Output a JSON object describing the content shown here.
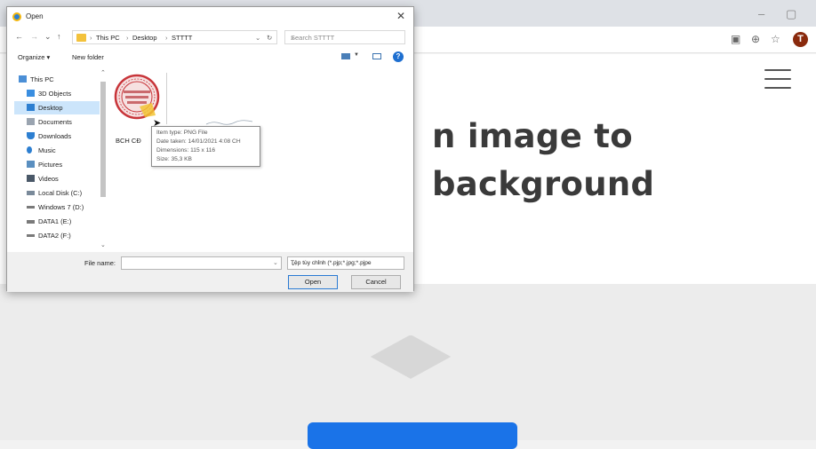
{
  "browser": {
    "window_controls": [
      "–",
      "▢"
    ],
    "profile_initial": "T",
    "headline_line1": "n image to",
    "headline_line2": "background"
  },
  "dialog": {
    "title": "Open",
    "close_glyph": "✕",
    "breadcrumbs": [
      "This PC",
      "Desktop",
      "STTTT"
    ],
    "search_placeholder": "Search STTTT",
    "organize_label": "Organize ▾",
    "new_folder_label": "New folder",
    "nav_items": [
      {
        "label": "This PC",
        "icon": "pc-icon"
      },
      {
        "label": "3D Objects",
        "icon": "3d-objects-icon"
      },
      {
        "label": "Desktop",
        "icon": "desktop-icon",
        "selected": true
      },
      {
        "label": "Documents",
        "icon": "documents-icon"
      },
      {
        "label": "Downloads",
        "icon": "downloads-icon"
      },
      {
        "label": "Music",
        "icon": "music-icon"
      },
      {
        "label": "Pictures",
        "icon": "pictures-icon"
      },
      {
        "label": "Videos",
        "icon": "videos-icon"
      },
      {
        "label": "Local Disk (C:)",
        "icon": "drive-icon"
      },
      {
        "label": "Windows 7 (D:)",
        "icon": "drive-icon"
      },
      {
        "label": "DATA1 (E:)",
        "icon": "drive-icon"
      },
      {
        "label": "DATA2 (F:)",
        "icon": "drive-icon"
      }
    ],
    "file": {
      "label": "BCH CĐ",
      "tooltip": [
        "Item type: PNG File",
        "Date taken: 14/01/2021 4:08 CH",
        "Dimensions: 115 x 116",
        "Size: 35,3 KB"
      ]
    },
    "file_name_label": "File name:",
    "file_name_value": "",
    "filter_value": "Tệp tùy chỉnh (*.pjp;*.jpg;*.pjpe",
    "open_label": "Open",
    "cancel_label": "Cancel"
  },
  "colors": {
    "accent": "#1a73e8",
    "selection": "#cce5fb"
  }
}
